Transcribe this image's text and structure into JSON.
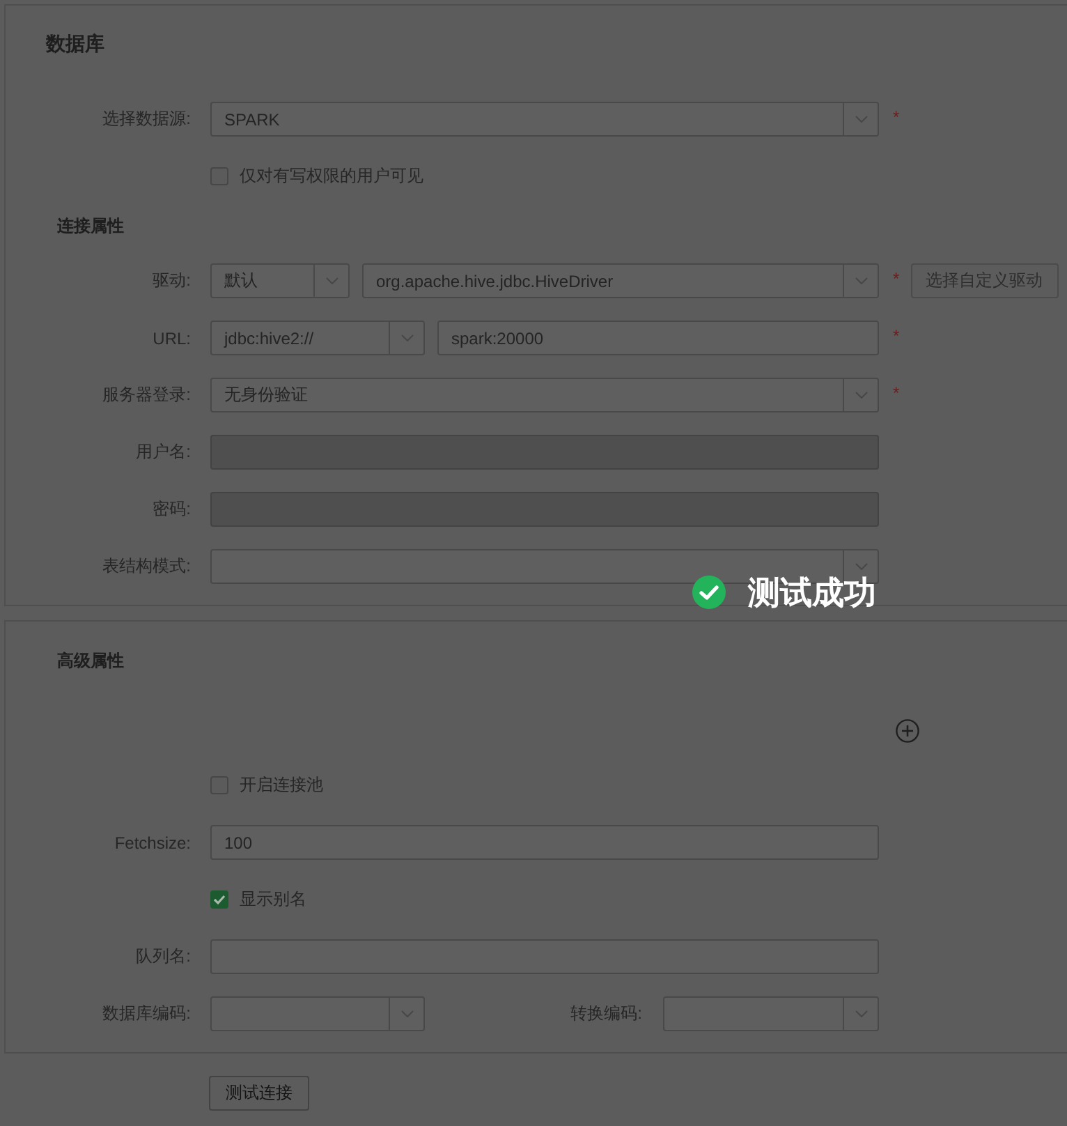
{
  "sections": [
    {
      "title": "数据库",
      "rows": [
        {
          "kind": "field",
          "label": "选择数据源:",
          "controls": [
            {
              "kind": "select",
              "value": "SPARK",
              "disabled": false
            }
          ],
          "required_mark": "*"
        },
        {
          "kind": "checkbox",
          "label": "仅对有写权限的用户可见",
          "checked": false
        },
        {
          "kind": "heading",
          "label": "连接属性"
        },
        {
          "kind": "driver",
          "label": "驱动:",
          "controls": [
            {
              "kind": "select",
              "value": "默认",
              "disabled": false
            },
            {
              "kind": "select",
              "value": "org.apache.hive.jdbc.HiveDriver",
              "disabled": false
            }
          ],
          "required_mark": "*",
          "button": {
            "label": "选择自定义驱动",
            "disabled": true
          }
        },
        {
          "kind": "url",
          "label": "URL:",
          "controls": [
            {
              "kind": "select",
              "value": "jdbc:hive2://",
              "disabled": false
            },
            {
              "kind": "input",
              "value": "spark:20000",
              "disabled": false
            }
          ],
          "required_mark": "*"
        },
        {
          "kind": "field",
          "label": "服务器登录:",
          "controls": [
            {
              "kind": "select",
              "value": "无身份验证",
              "disabled": false
            }
          ],
          "required_mark": "*"
        },
        {
          "kind": "field",
          "label": "用户名:",
          "controls": [
            {
              "kind": "input",
              "disabled": true
            }
          ]
        },
        {
          "kind": "field",
          "label": "密码:",
          "controls": [
            {
              "kind": "input",
              "disabled": true
            }
          ]
        },
        {
          "kind": "field",
          "label": "表结构模式:",
          "controls": [
            {
              "kind": "select",
              "disabled": false
            }
          ]
        }
      ]
    },
    {
      "rows": [
        {
          "kind": "heading",
          "label": "高级属性"
        },
        {
          "kind": "add"
        },
        {
          "kind": "checkbox",
          "label": "开启连接池",
          "checked": false
        },
        {
          "kind": "field",
          "label": "Fetchsize:",
          "controls": [
            {
              "kind": "input",
              "value": "100",
              "disabled": false
            }
          ]
        },
        {
          "kind": "checkbox",
          "label": "显示别名",
          "checked": true
        },
        {
          "kind": "field",
          "label": "队列名:",
          "controls": [
            {
              "kind": "input",
              "disabled": false
            }
          ]
        },
        {
          "kind": "encoding",
          "label": "数据库编码:",
          "controls": [
            {
              "kind": "select",
              "disabled": false
            },
            {
              "kind": "select",
              "label": "转换编码:",
              "disabled": false
            }
          ]
        }
      ]
    }
  ],
  "actions": [
    {
      "label": "测试连接",
      "disabled": false
    }
  ],
  "toast": {
    "kind": "success",
    "message": "测试成功"
  }
}
